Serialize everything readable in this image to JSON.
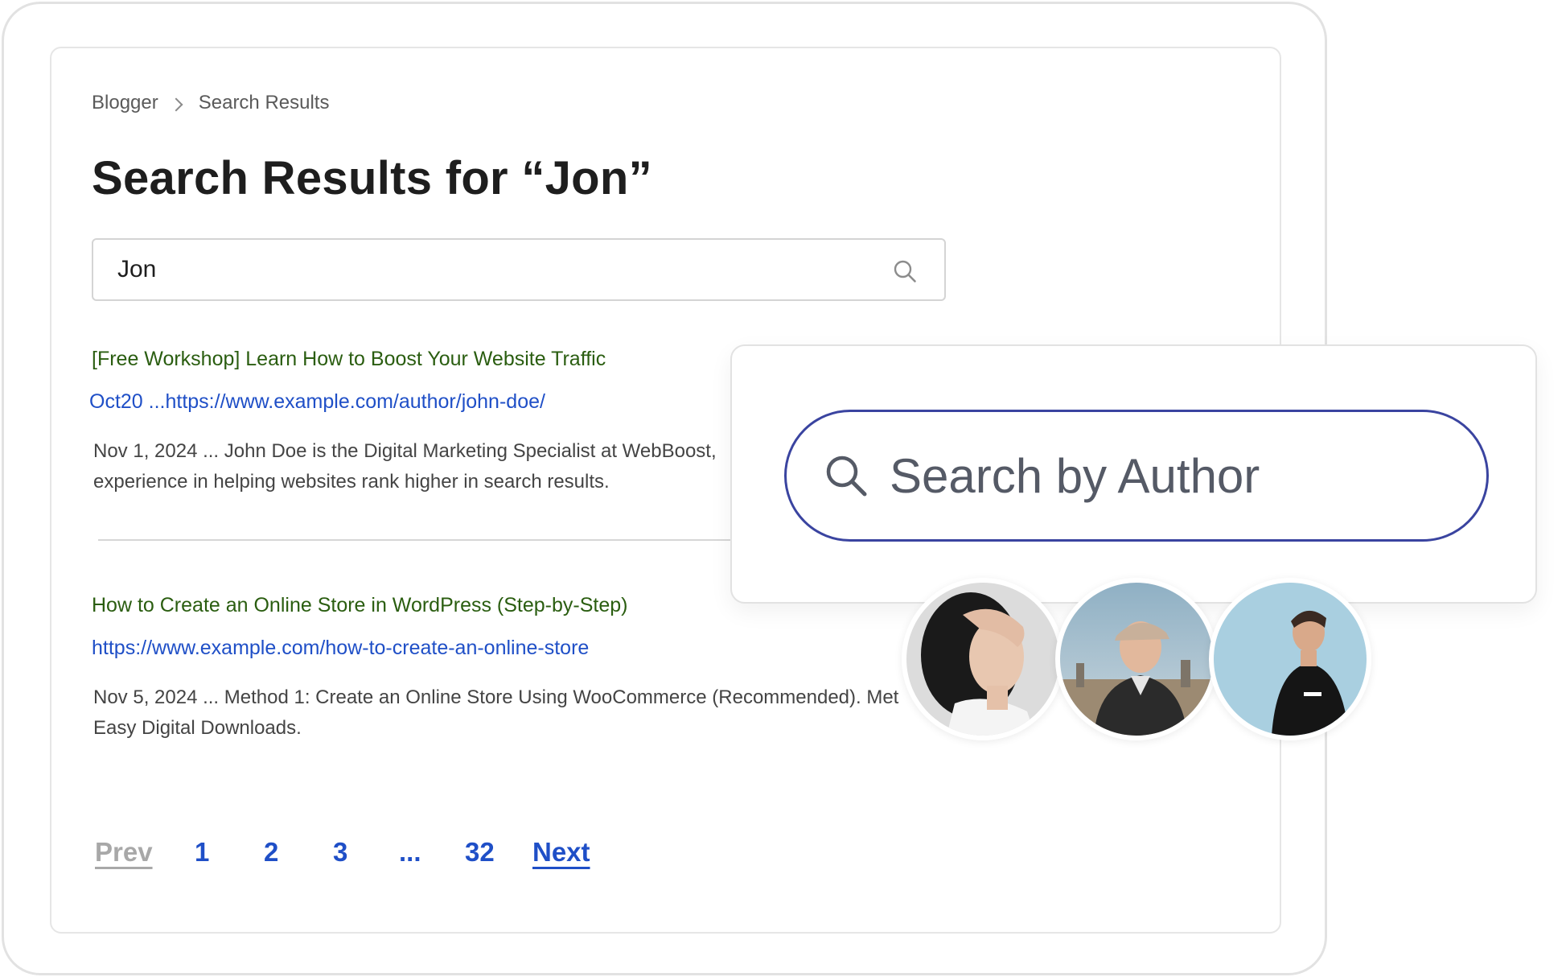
{
  "breadcrumb": {
    "root": "Blogger",
    "current": "Search Results"
  },
  "page": {
    "title": "Search Results for “Jon”"
  },
  "search": {
    "value": "Jon",
    "icon": "search-icon"
  },
  "results": [
    {
      "title": "[Free Workshop] Learn How to Boost Your Website Traffic",
      "url": "Oct20 ...https://www.example.com/author/john-doe/",
      "snippet_line1": "Nov 1, 2024 ... John Doe is the Digital Marketing Specialist at WebBoost,",
      "snippet_line2": "experience in helping websites rank higher in search results."
    },
    {
      "title": "How to Create an Online Store in WordPress (Step-by-Step)",
      "url": "https://www.example.com/how-to-create-an-online-store",
      "snippet_line1": "Nov 5, 2024 ... Method 1: Create an Online Store Using WooCommerce (Recommended). Met",
      "snippet_line2": "Easy Digital Downloads."
    }
  ],
  "pagination": {
    "prev": "Prev",
    "pages": [
      "1",
      "2",
      "3",
      "...",
      "32"
    ],
    "next": "Next"
  },
  "author_search": {
    "placeholder": "Search by Author",
    "icon": "search-icon",
    "border_color": "#3a44a0"
  },
  "colors": {
    "result_title": "#2a5d10",
    "result_url": "#1f4fc7",
    "pagination_active": "#1f4fc7",
    "pagination_disabled": "#a8a8a8"
  }
}
